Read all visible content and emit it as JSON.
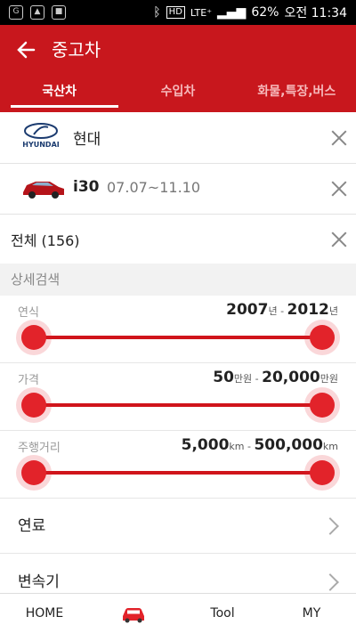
{
  "status": {
    "battery": "62%",
    "time": "오전 11:34",
    "lte": "LTE⁺",
    "hd": "HD"
  },
  "appbar": {
    "title": "중고차"
  },
  "tabs": [
    {
      "label": "국산차"
    },
    {
      "label": "수입차"
    },
    {
      "label": "화물,특장,버스"
    }
  ],
  "filters": {
    "maker": {
      "logo_text": "HYUNDAI",
      "name": "현대"
    },
    "model": {
      "name": "i30",
      "years": "07.07~11.10"
    },
    "all": {
      "label": "전체 (156)"
    }
  },
  "section": {
    "label": "상세검색"
  },
  "sliders": [
    {
      "label": "연식",
      "min": "2007",
      "min_unit": "년",
      "sep": " - ",
      "max": "2012",
      "max_unit": "년"
    },
    {
      "label": "가격",
      "min": "50",
      "min_unit": "만원",
      "sep": " - ",
      "max": "20,000",
      "max_unit": "만원"
    },
    {
      "label": "주행거리",
      "min": "5,000",
      "min_unit": "km",
      "sep": " - ",
      "max": "500,000",
      "max_unit": "km"
    }
  ],
  "menu": [
    {
      "label": "연료"
    },
    {
      "label": "변속기"
    }
  ],
  "bottom": {
    "home": "HOME",
    "tool": "Tool",
    "my": "MY"
  },
  "colors": {
    "brand": "#c8171d",
    "slider": "#e2232a"
  }
}
